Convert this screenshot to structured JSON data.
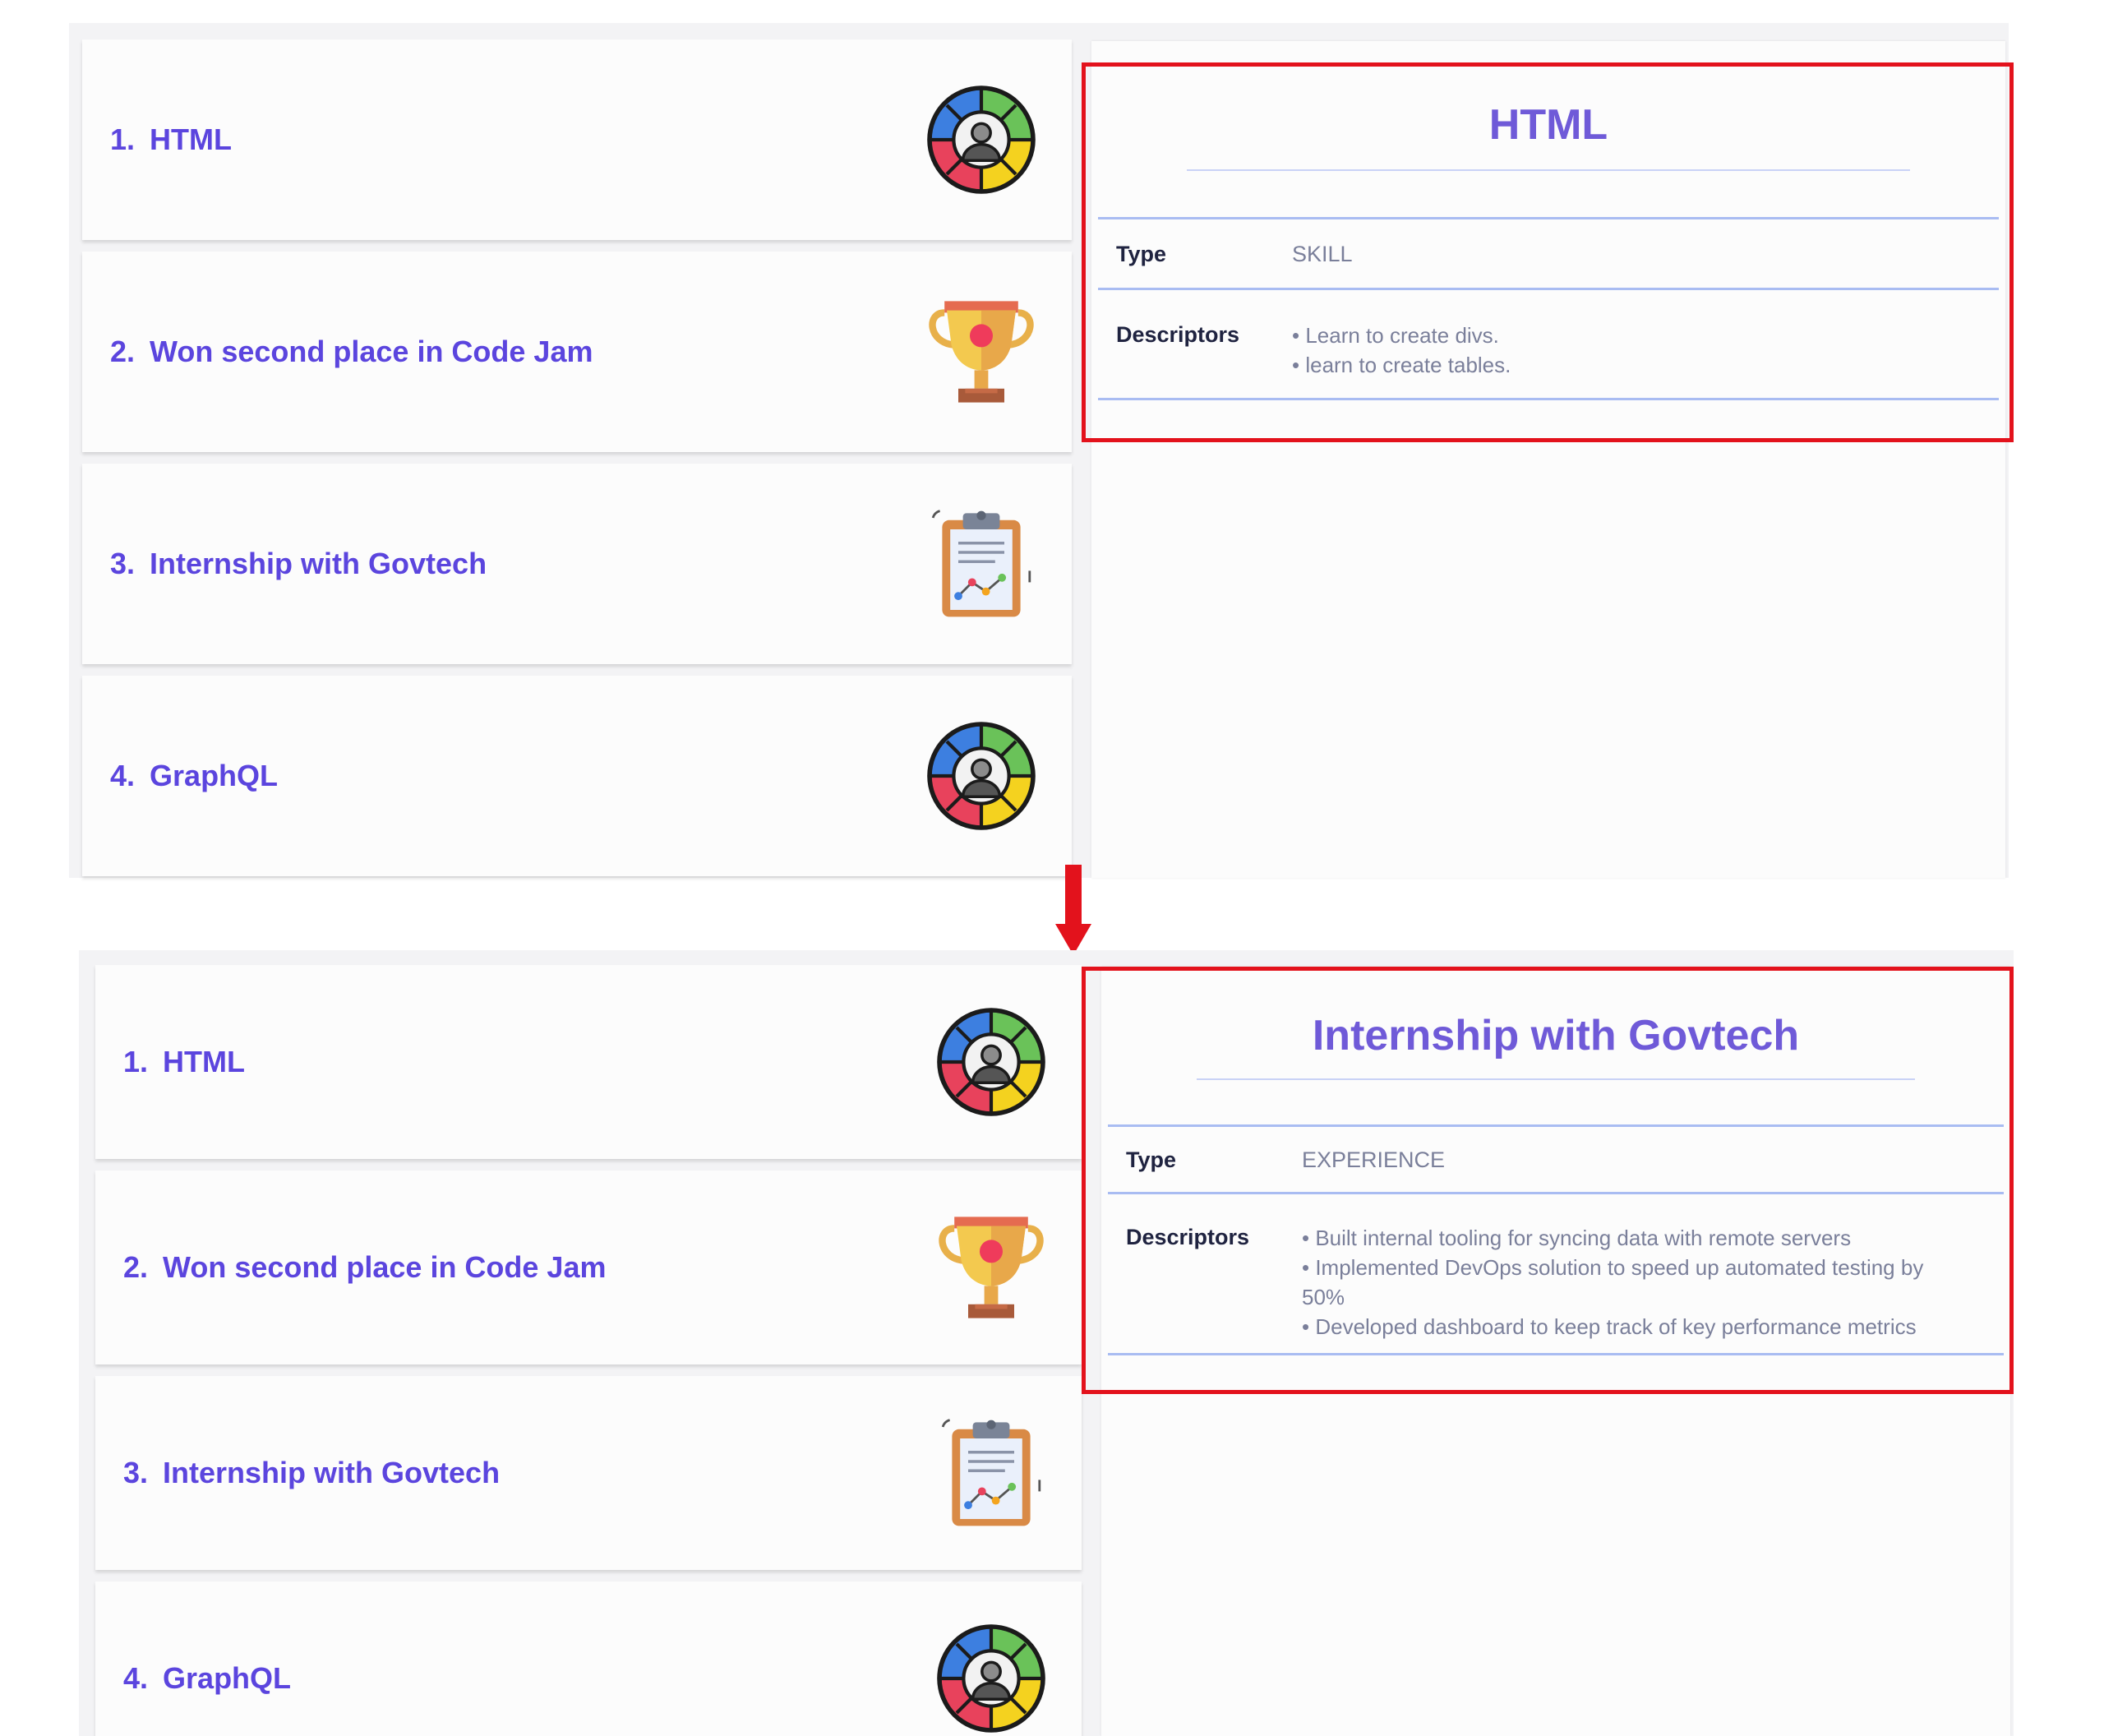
{
  "top": {
    "list_items": [
      {
        "number": "1.",
        "title": "HTML",
        "icon": "skill-wheel-icon"
      },
      {
        "number": "2.",
        "title": "Won second place in Code Jam",
        "icon": "trophy-icon"
      },
      {
        "number": "3.",
        "title": "Internship with Govtech",
        "icon": "clipboard-chart-icon"
      },
      {
        "number": "4.",
        "title": "GraphQL",
        "icon": "skill-wheel-icon"
      }
    ],
    "detail": {
      "title": "HTML",
      "type_label": "Type",
      "type_value": "SKILL",
      "descriptors_label": "Descriptors",
      "descriptors": [
        "Learn to create divs.",
        "learn to create tables."
      ]
    }
  },
  "bottom": {
    "list_items": [
      {
        "number": "1.",
        "title": "HTML",
        "icon": "skill-wheel-icon"
      },
      {
        "number": "2.",
        "title": "Won second place in Code Jam",
        "icon": "trophy-icon"
      },
      {
        "number": "3.",
        "title": "Internship with Govtech",
        "icon": "clipboard-chart-icon"
      },
      {
        "number": "4.",
        "title": "GraphQL",
        "icon": "skill-wheel-icon"
      }
    ],
    "detail": {
      "title": "Internship with Govtech",
      "type_label": "Type",
      "type_value": "EXPERIENCE",
      "descriptors_label": "Descriptors",
      "descriptors": [
        "Built internal tooling for syncing data with remote servers",
        "Implemented DevOps solution to speed up automated testing by",
        "50%",
        "Developed dashboard to keep track of key performance metrics"
      ]
    }
  },
  "colors": {
    "accent": "#5b45de",
    "title": "#6f5ad8",
    "highlight": "#e3121c",
    "rule": "#a9bcf2"
  }
}
